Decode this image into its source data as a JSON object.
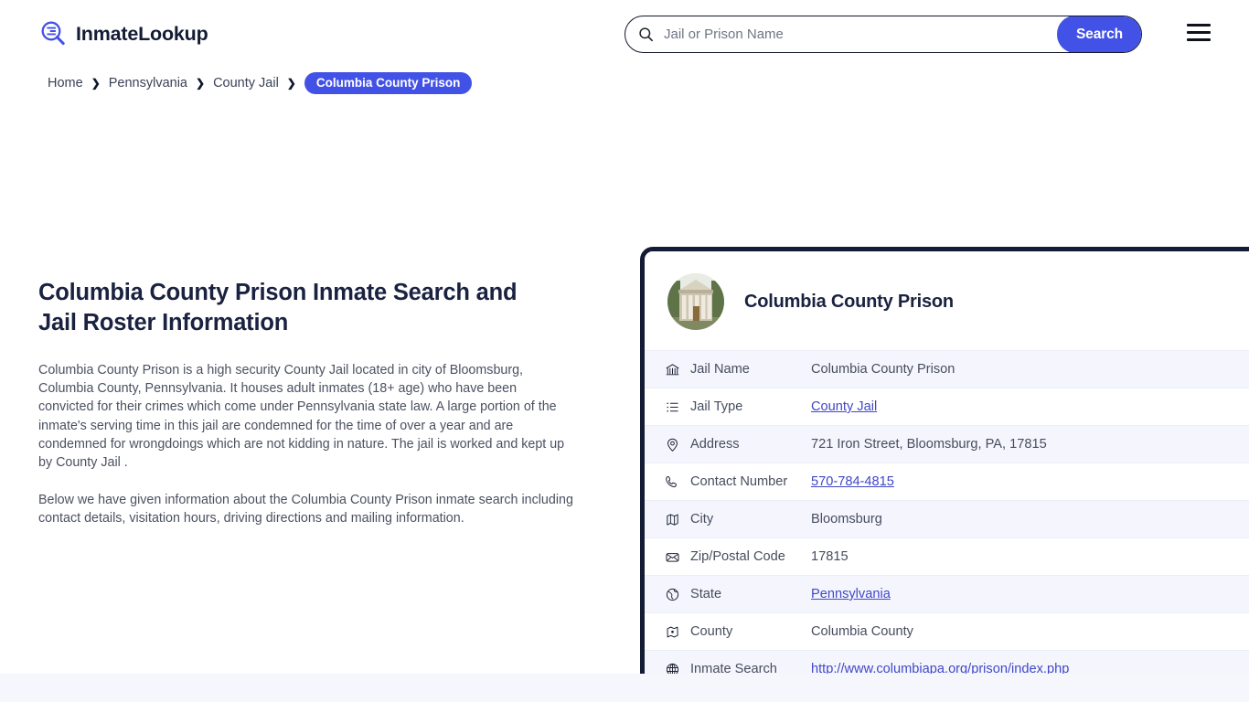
{
  "brand": {
    "name": "InmateLookup",
    "logo_icon": "magnifier-list-icon"
  },
  "search": {
    "placeholder": "Jail or Prison Name",
    "value": "",
    "button_label": "Search",
    "icon": "search-icon"
  },
  "menu": {
    "icon": "hamburger-menu-icon"
  },
  "breadcrumb": {
    "items": [
      {
        "label": "Home",
        "current": false
      },
      {
        "label": "Pennsylvania",
        "current": false
      },
      {
        "label": "County Jail",
        "current": false
      },
      {
        "label": "Columbia County Prison",
        "current": true
      }
    ],
    "separator": "❯"
  },
  "article": {
    "title": "Columbia County Prison Inmate Search and Jail Roster Information",
    "paragraphs": [
      "Columbia County Prison is a high security County Jail located in city of Bloomsburg, Columbia County, Pennsylvania. It houses adult inmates (18+ age) who have been convicted for their crimes which come under Pennsylvania state law. A large portion of the inmate's serving time in this jail are condemned for the time of over a year and are condemned for wrongdoings which are not kidding in nature. The jail is worked and kept up by County Jail .",
      "Below we have given information about the Columbia County Prison inmate search including contact details, visitation hours, driving directions and mailing information."
    ]
  },
  "info_card": {
    "title": "Columbia County Prison",
    "avatar_icon": "courthouse-photo",
    "rows": [
      {
        "icon": "bank-building-icon",
        "label": "Jail Name",
        "value": "Columbia County Prison",
        "is_link": false
      },
      {
        "icon": "list-icon",
        "label": "Jail Type",
        "value": "County Jail",
        "is_link": true
      },
      {
        "icon": "map-pin-icon",
        "label": "Address",
        "value": "721 Iron Street, Bloomsburg, PA, 17815",
        "is_link": false
      },
      {
        "icon": "phone-icon",
        "label": "Contact Number",
        "value": "570-784-4815",
        "is_link": true
      },
      {
        "icon": "map-icon",
        "label": "City",
        "value": "Bloomsburg",
        "is_link": false
      },
      {
        "icon": "envelope-icon",
        "label": "Zip/Postal Code",
        "value": "17815",
        "is_link": false
      },
      {
        "icon": "globe-americas-icon",
        "label": "State",
        "value": "Pennsylvania",
        "is_link": true
      },
      {
        "icon": "county-marker-icon",
        "label": "County",
        "value": "Columbia County",
        "is_link": false
      },
      {
        "icon": "globe-grid-icon",
        "label": "Inmate Search",
        "value": "http://www.columbiapa.org/prison/index.php",
        "is_link": true
      }
    ]
  },
  "colors": {
    "accent_blue": "#4352e6",
    "link_blue": "#4047c8",
    "dark_navy": "#141b34",
    "row_alt": "#f5f6fd",
    "footer_strip": "#f6f6fd"
  }
}
